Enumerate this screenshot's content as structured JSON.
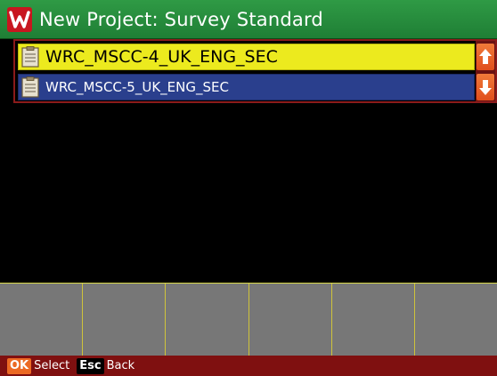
{
  "window": {
    "title": "New Project: Survey Standard",
    "logo_icon": "wiltronix-logo-icon"
  },
  "list": {
    "items": [
      {
        "label": "WRC_MSCC-4_UK_ENG_SEC",
        "icon": "document-icon",
        "selected": true
      },
      {
        "label": "WRC_MSCC-5_UK_ENG_SEC",
        "icon": "document-icon",
        "selected": false
      }
    ]
  },
  "scrollbar": {
    "up_icon": "arrow-up-icon",
    "down_icon": "arrow-down-icon"
  },
  "softkeys": [
    "",
    "",
    "",
    "",
    "",
    ""
  ],
  "footer": {
    "ok_key": "OK",
    "ok_label": "Select",
    "esc_key": "Esc",
    "esc_label": "Back"
  },
  "colors": {
    "titlebar": "#2a8f3f",
    "selected_item": "#ecea1e",
    "unselected_item": "#2a3f8d",
    "footer": "#7f1010",
    "accent": "#ec6a24"
  }
}
